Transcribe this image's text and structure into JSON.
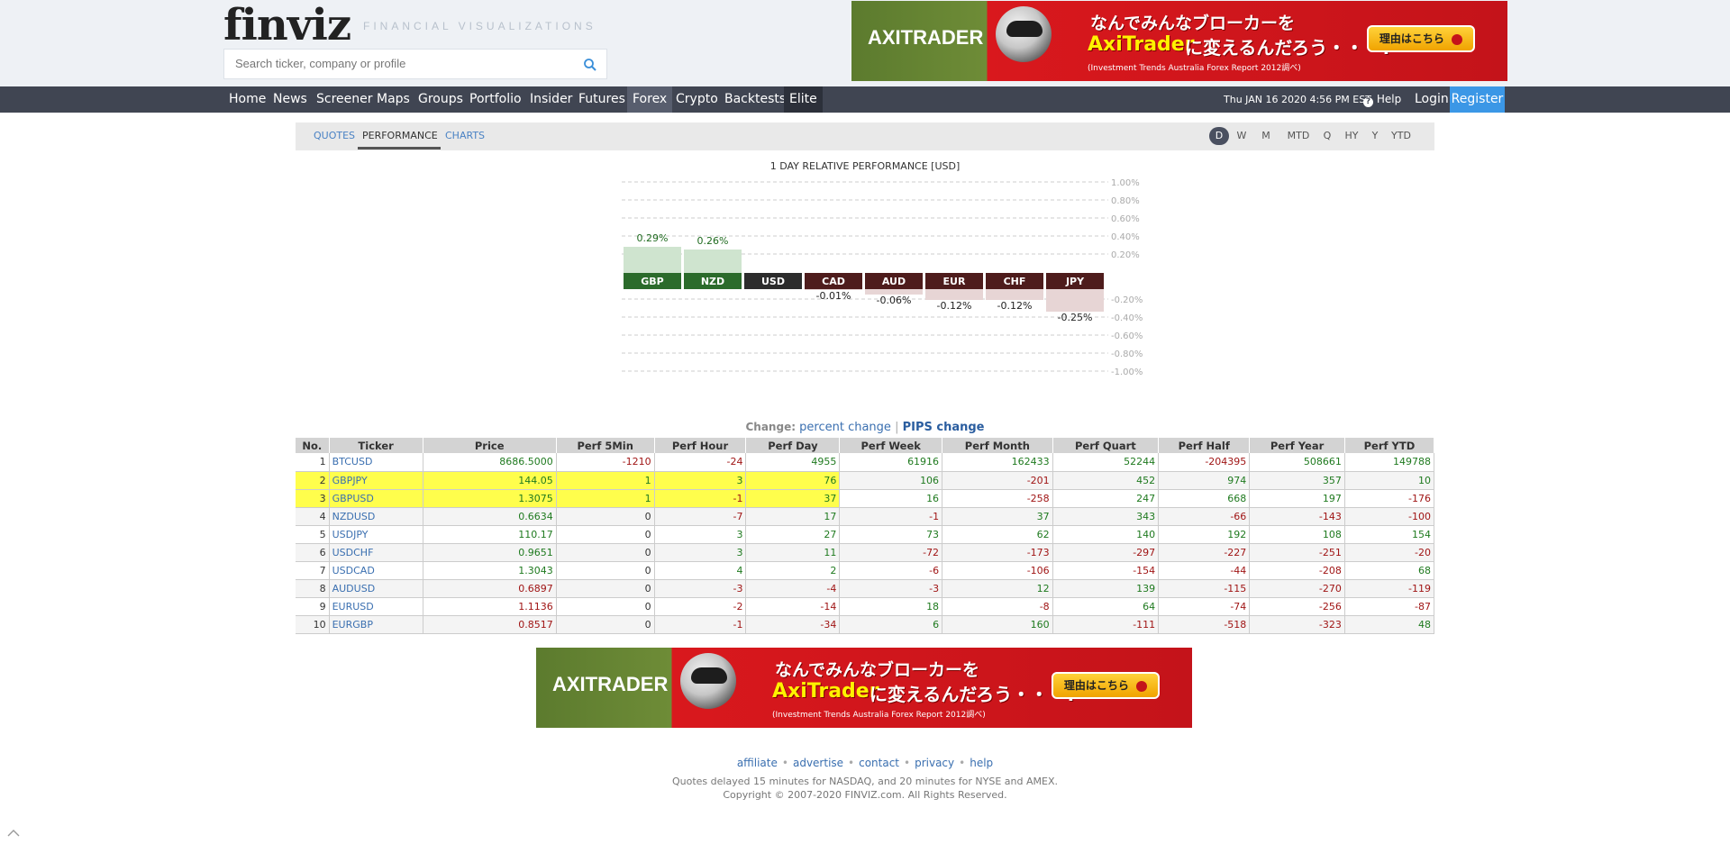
{
  "header": {
    "logo": "finviz",
    "tagline": "FINANCIAL VISUALIZATIONS",
    "search_placeholder": "Search ticker, company or profile"
  },
  "ad_top": {
    "brand": "AXITRADER",
    "line1": "なんでみんなブローカーを",
    "line2a": "AxiTrader",
    "line2b": "に変えるんだろう・・・?",
    "small": "(Investment Trends Australia Forex Report 2012調べ)",
    "cta": "理由はこちら"
  },
  "nav": {
    "items": [
      "Home",
      "News",
      "Screener",
      "Maps",
      "Groups",
      "Portfolio",
      "Insider",
      "Futures",
      "Forex",
      "Crypto",
      "Backtests",
      "Elite"
    ],
    "active": "Forex",
    "date": "Thu JAN 16 2020 4:56 PM EST",
    "help": "Help",
    "login": "Login",
    "register": "Register"
  },
  "subtabs": [
    "QUOTES",
    "PERFORMANCE",
    "CHARTS"
  ],
  "active_subtab": "PERFORMANCE",
  "periods": [
    "D",
    "W",
    "M",
    "MTD",
    "Q",
    "HY",
    "Y",
    "YTD"
  ],
  "active_period": "D",
  "chart_data": {
    "type": "bar",
    "title": "1 DAY RELATIVE PERFORMANCE  [USD]",
    "categories": [
      "GBP",
      "NZD",
      "USD",
      "CAD",
      "AUD",
      "EUR",
      "CHF",
      "JPY"
    ],
    "values": [
      0.29,
      0.26,
      0.0,
      -0.01,
      -0.06,
      -0.12,
      -0.12,
      -0.25
    ],
    "value_labels": [
      "0.29%",
      "0.26%",
      "",
      "-0.01%",
      "-0.06%",
      "-0.12%",
      "-0.12%",
      "-0.25%"
    ],
    "ylim": [
      -1.0,
      1.0
    ],
    "yticks_top": [
      "1.00%",
      "0.80%",
      "0.60%",
      "0.40%",
      "0.20%"
    ],
    "yticks_bottom": [
      "-0.20%",
      "-0.40%",
      "-0.60%",
      "-0.80%",
      "-1.00%"
    ],
    "colors": {
      "pos_bar": "#cfe4cf",
      "neg_bar": "#e7d5d5",
      "pos_label": "#2b6b2b",
      "neg_label": "#4e1c1c",
      "flat_label": "#2c2c2c",
      "pos_text": "#1f6b1f"
    }
  },
  "change": {
    "label": "Change:",
    "percent": "percent change",
    "sep": "|",
    "pips": "PIPS change"
  },
  "table": {
    "headers": [
      "No.",
      "Ticker",
      "Price",
      "Perf 5Min",
      "Perf Hour",
      "Perf Day",
      "Perf Week",
      "Perf Month",
      "Perf Quart",
      "Perf Half",
      "Perf Year",
      "Perf YTD"
    ],
    "rows": [
      {
        "no": "1",
        "ticker": "BTCUSD",
        "price": "8686.5000",
        "vals": [
          "-1210",
          "-24",
          "4955",
          "61916",
          "162433",
          "52244",
          "-204395",
          "508661",
          "149788"
        ],
        "price_class": "pos",
        "hl": false
      },
      {
        "no": "2",
        "ticker": "GBPJPY",
        "price": "144.05",
        "vals": [
          "1",
          "3",
          "76",
          "106",
          "-201",
          "452",
          "974",
          "357",
          "10"
        ],
        "price_class": "pos",
        "hl": true
      },
      {
        "no": "3",
        "ticker": "GBPUSD",
        "price": "1.3075",
        "vals": [
          "1",
          "-1",
          "37",
          "16",
          "-258",
          "247",
          "668",
          "197",
          "-176"
        ],
        "price_class": "pos",
        "hl": true
      },
      {
        "no": "4",
        "ticker": "NZDUSD",
        "price": "0.6634",
        "vals": [
          "0",
          "-7",
          "17",
          "-1",
          "37",
          "343",
          "-66",
          "-143",
          "-100"
        ],
        "price_class": "pos",
        "hl": false
      },
      {
        "no": "5",
        "ticker": "USDJPY",
        "price": "110.17",
        "vals": [
          "0",
          "3",
          "27",
          "73",
          "62",
          "140",
          "192",
          "108",
          "154"
        ],
        "price_class": "pos",
        "hl": false
      },
      {
        "no": "6",
        "ticker": "USDCHF",
        "price": "0.9651",
        "vals": [
          "0",
          "3",
          "11",
          "-72",
          "-173",
          "-297",
          "-227",
          "-251",
          "-20"
        ],
        "price_class": "pos",
        "hl": false
      },
      {
        "no": "7",
        "ticker": "USDCAD",
        "price": "1.3043",
        "vals": [
          "0",
          "4",
          "2",
          "-6",
          "-106",
          "-154",
          "-44",
          "-208",
          "68"
        ],
        "price_class": "pos",
        "hl": false
      },
      {
        "no": "8",
        "ticker": "AUDUSD",
        "price": "0.6897",
        "vals": [
          "0",
          "-3",
          "-4",
          "-3",
          "12",
          "139",
          "-115",
          "-270",
          "-119"
        ],
        "price_class": "neg",
        "hl": false
      },
      {
        "no": "9",
        "ticker": "EURUSD",
        "price": "1.1136",
        "vals": [
          "0",
          "-2",
          "-14",
          "18",
          "-8",
          "64",
          "-74",
          "-256",
          "-87"
        ],
        "price_class": "neg",
        "hl": false
      },
      {
        "no": "10",
        "ticker": "EURGBP",
        "price": "0.8517",
        "vals": [
          "0",
          "-1",
          "-34",
          "6",
          "160",
          "-111",
          "-518",
          "-323",
          "48"
        ],
        "price_class": "neg",
        "hl": false
      }
    ]
  },
  "ad_bottom": {
    "brand": "AXITRADER",
    "line1": "なんでみんなブローカーを",
    "line2a": "AxiTrader",
    "line2b": "に変えるんだろう・・・?",
    "small": "(Investment Trends Australia Forex Report 2012調べ)",
    "cta": "理由はこちら"
  },
  "footer": {
    "links": [
      "affiliate",
      "advertise",
      "contact",
      "privacy",
      "help"
    ],
    "note": "Quotes delayed 15 minutes for NASDAQ, and 20 minutes for NYSE and AMEX.",
    "copyright": "Copyright © 2007-2020 FINVIZ.com. All Rights Reserved."
  }
}
